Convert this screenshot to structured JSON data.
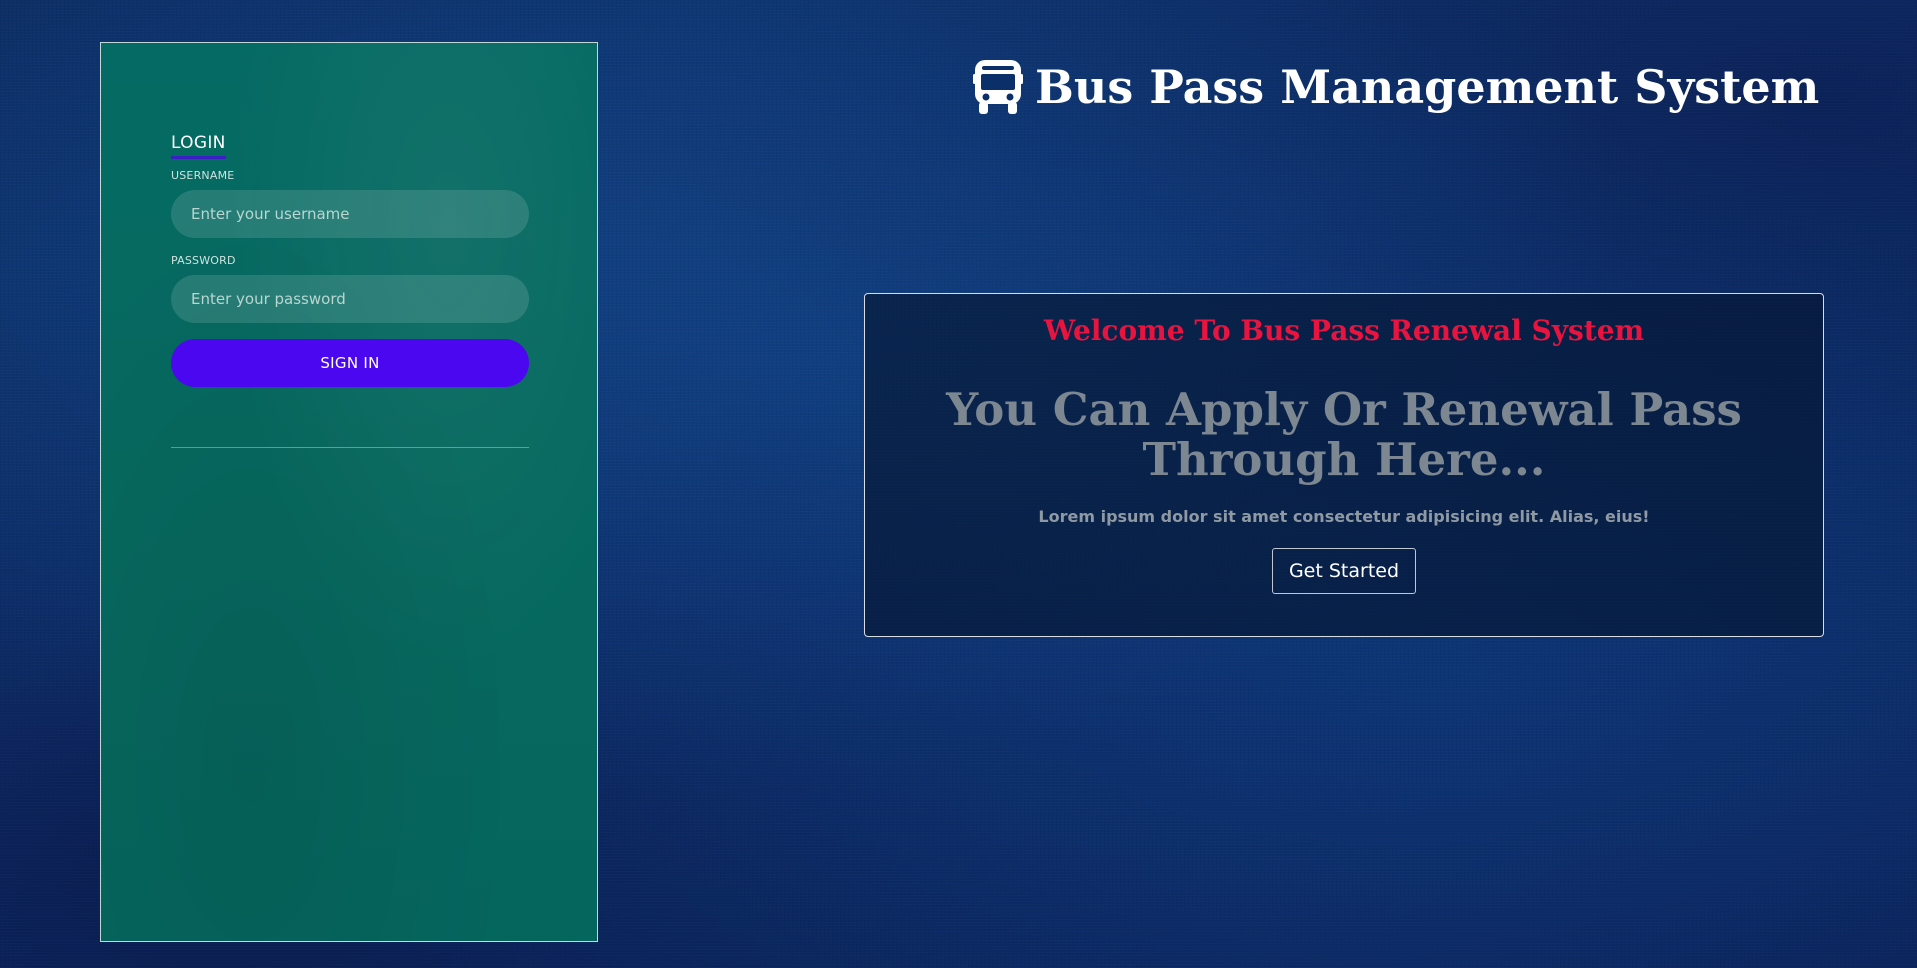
{
  "login": {
    "tab_label": "LOGIN",
    "username_label": "USERNAME",
    "username_placeholder": "Enter your username",
    "password_label": "PASSWORD",
    "password_placeholder": "Enter your password",
    "sign_in_label": "SIGN IN"
  },
  "header": {
    "icon": "bus-icon",
    "title": "Bus Pass Management System"
  },
  "welcome": {
    "title": "Welcome To Bus Pass Renewal System",
    "heading": "You Can Apply Or Renewal Pass Through Here...",
    "text": "Lorem ipsum dolor sit amet consectetur adipisicing elit. Alias, eius!",
    "button_label": "Get Started"
  },
  "colors": {
    "accent": "#4a07f0",
    "panel": "#056a63",
    "welcome_title": "#e8133f"
  }
}
